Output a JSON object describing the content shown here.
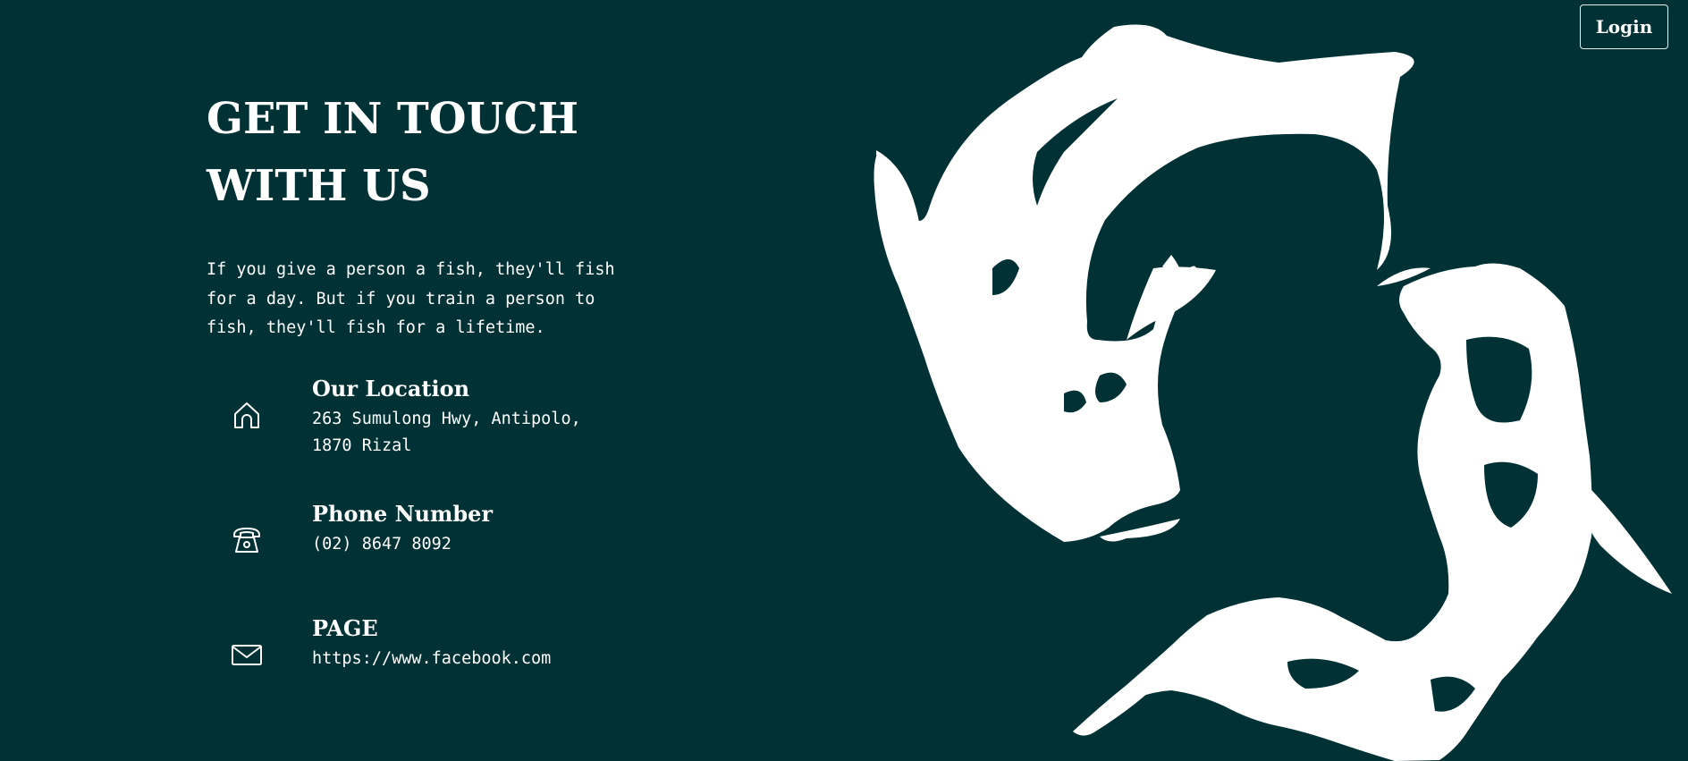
{
  "header": {
    "login_label": "Login"
  },
  "hero": {
    "title": "GET IN TOUCH WITH US",
    "quote": "If you give a person a fish, they'll fish for a day. But if you train a person to fish, they'll fish for a lifetime."
  },
  "contacts": [
    {
      "icon": "home-icon",
      "heading": "Our Location",
      "value": "263 Sumulong Hwy, Antipolo, 1870 Rizal"
    },
    {
      "icon": "telephone-icon",
      "heading": "Phone Number",
      "value": "(02) 8647 8092"
    },
    {
      "icon": "envelope-icon",
      "heading": "PAGE",
      "value": "https://www.facebook.com"
    }
  ],
  "colors": {
    "background": "#003235",
    "foreground": "#ffffff"
  }
}
